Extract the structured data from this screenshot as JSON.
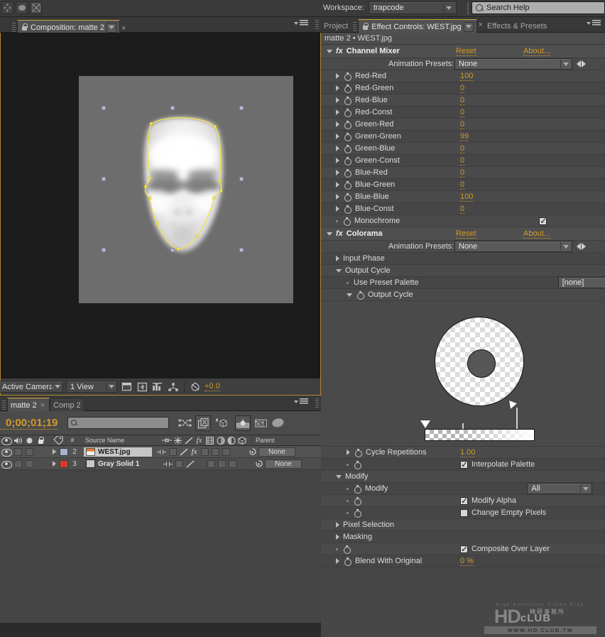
{
  "topbar": {
    "workspace_label": "Workspace:",
    "workspace_value": "trapcode",
    "search_placeholder": "Search Help",
    "search_value": "Search Help"
  },
  "comp_panel": {
    "tab_label": "Composition: matte 2"
  },
  "comp_toolbar": {
    "camera_view": "Active Camera",
    "view_layout": "1 View",
    "exposure_value": "+0.0"
  },
  "timeline": {
    "tabs": [
      {
        "label": "matte 2",
        "active": true,
        "closable": true
      },
      {
        "label": "Comp 2",
        "active": false,
        "closable": false
      }
    ],
    "timecode": "0;00;01;19",
    "search_value": "",
    "columns": {
      "num": "#",
      "source_name": "Source Name",
      "parent": "Parent"
    },
    "layers": [
      {
        "index": "2",
        "name": "WEST.jpg",
        "label_color": "#aab0cf",
        "parent": "None",
        "has_fx": true
      },
      {
        "index": "3",
        "name": "Gray Solid 1",
        "label_color": "#d83a2a",
        "parent": "None",
        "has_fx": false
      }
    ]
  },
  "effect_controls": {
    "tabs": [
      {
        "label": "Project",
        "active": false
      },
      {
        "label": "Effect Controls: WEST.jpg",
        "active": true
      },
      {
        "label": "Effects & Presets",
        "active": false
      }
    ],
    "breadcrumb": "matte 2 • WEST.jpg",
    "reset_label": "Reset",
    "about_label": "About...",
    "animation_presets_label": "Animation Presets:",
    "animation_presets_value": "None",
    "effects": [
      {
        "name": "Channel Mixer",
        "params": [
          {
            "label": "Red-Red",
            "value": "100",
            "type": "number"
          },
          {
            "label": "Red-Green",
            "value": "0",
            "type": "number"
          },
          {
            "label": "Red-Blue",
            "value": "0",
            "type": "number"
          },
          {
            "label": "Red-Const",
            "value": "0",
            "type": "number"
          },
          {
            "label": "Green-Red",
            "value": "0",
            "type": "number"
          },
          {
            "label": "Green-Green",
            "value": "99",
            "type": "number"
          },
          {
            "label": "Green-Blue",
            "value": "0",
            "type": "number"
          },
          {
            "label": "Green-Const",
            "value": "0",
            "type": "number"
          },
          {
            "label": "Blue-Red",
            "value": "0",
            "type": "number"
          },
          {
            "label": "Blue-Green",
            "value": "0",
            "type": "number"
          },
          {
            "label": "Blue-Blue",
            "value": "100",
            "type": "number"
          },
          {
            "label": "Blue-Const",
            "value": "0",
            "type": "number"
          },
          {
            "label": "Monochrome",
            "value": "",
            "type": "checkbox",
            "checked": true
          }
        ]
      },
      {
        "name": "Colorama",
        "groups": [
          {
            "label": "Input Phase",
            "open": false
          },
          {
            "label": "Output Cycle",
            "open": true
          },
          {
            "label": "Modify",
            "open": true
          },
          {
            "label": "Pixel Selection",
            "open": false
          },
          {
            "label": "Masking",
            "open": false
          }
        ],
        "use_preset_palette_label": "Use Preset Palette",
        "use_preset_palette_value": "[none]",
        "output_cycle_label": "Output Cycle",
        "cycle_repetitions_label": "Cycle Repetitions",
        "cycle_repetitions_value": "1.00",
        "interpolate_palette_label": "Interpolate Palette",
        "interpolate_palette_checked": true,
        "modify_label": "Modify",
        "modify_value": "All",
        "modify_alpha_label": "Modify Alpha",
        "modify_alpha_checked": true,
        "change_empty_pixels_label": "Change Empty Pixels",
        "change_empty_pixels_checked": false,
        "composite_over_layer_label": "Composite Over Layer",
        "composite_over_layer_checked": true,
        "blend_with_original_label": "Blend With Original",
        "blend_with_original_value": "0 %"
      }
    ]
  },
  "watermark": {
    "tagline": "High Definition Vision Club",
    "brand_hd": "HD",
    "brand_club": "cLUB",
    "brand_cn": "精研事務所",
    "url": "WWW.HD.CLUB.TW"
  },
  "colors": {
    "accent_orange": "#d39b2a",
    "panel_bg": "#4a4a4a",
    "mask_outline": "#f3e24a"
  }
}
